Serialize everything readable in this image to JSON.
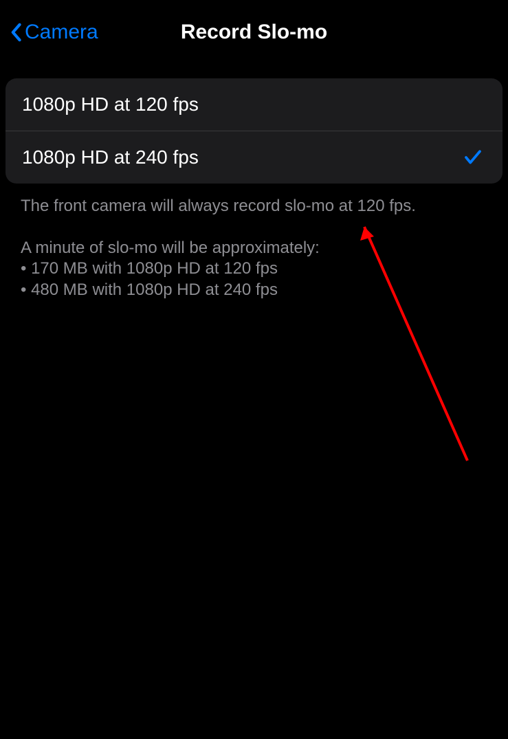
{
  "nav": {
    "back_label": "Camera",
    "title": "Record Slo-mo"
  },
  "options": [
    {
      "label": "1080p HD at 120 fps",
      "selected": false
    },
    {
      "label": "1080p HD at 240 fps",
      "selected": true
    }
  ],
  "footer": {
    "line1": "The front camera will always record slo-mo at 120 fps.",
    "line2": "A minute of slo-mo will be approximately:",
    "bullet1": "• 170 MB with 1080p HD at 120 fps",
    "bullet2": "• 480 MB with 1080p HD at 240 fps"
  },
  "colors": {
    "accent": "#007AFF",
    "background": "#000000",
    "group_background": "#1c1c1e",
    "footer_text": "#8e8e93",
    "annotation": "#ff0000"
  }
}
